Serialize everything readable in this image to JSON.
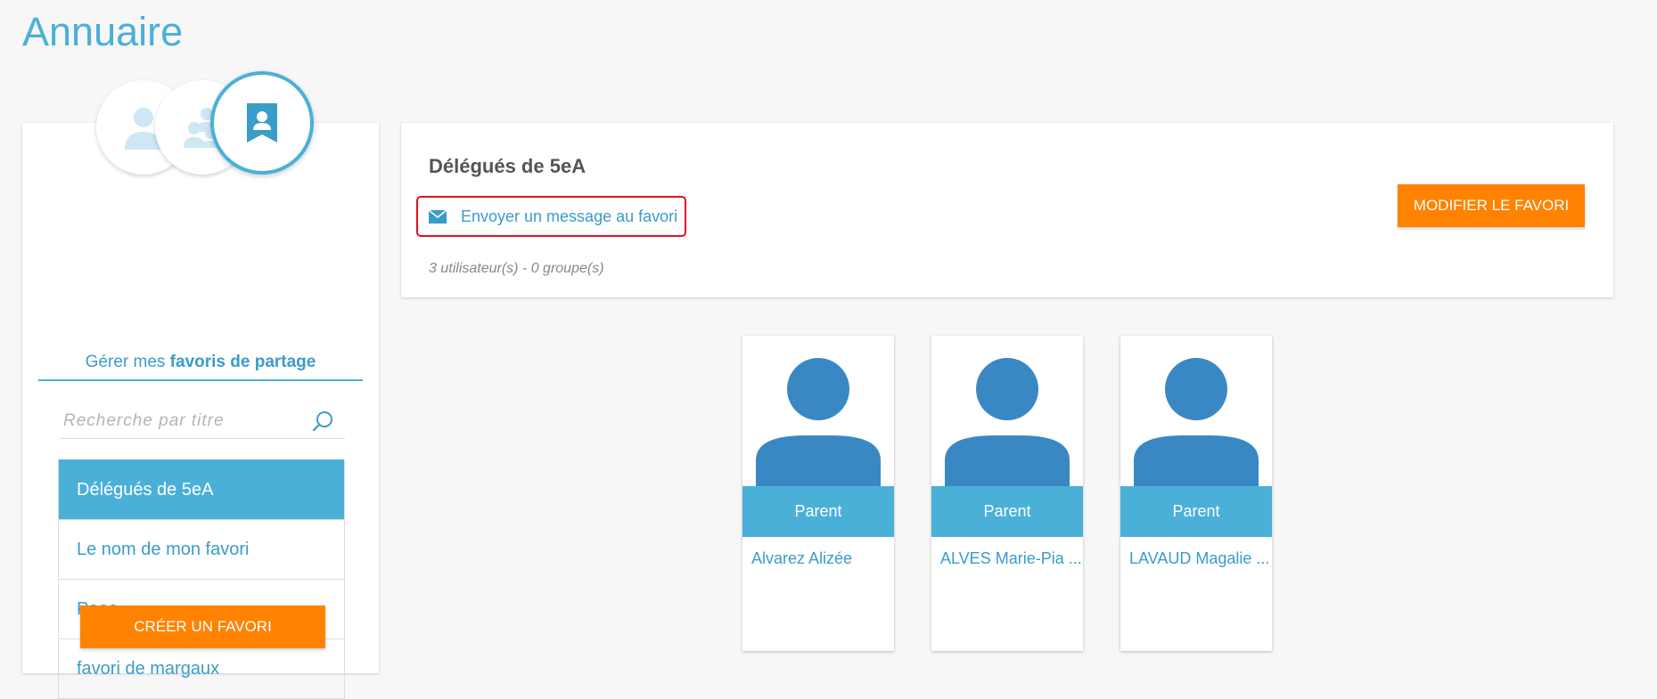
{
  "page": {
    "title": "Annuaire"
  },
  "sidebar": {
    "manage_label_prefix": "Gérer mes ",
    "manage_label_bold": "favoris de partage",
    "search_placeholder": "Recherche par titre",
    "favorites": [
      {
        "label": "Délégués de 5eA",
        "active": true
      },
      {
        "label": "Le nom de mon favori",
        "active": false
      },
      {
        "label": "Paoa",
        "active": false
      },
      {
        "label": "favori de margaux",
        "active": false
      }
    ],
    "create_button": "CRÉER UN FAVORI"
  },
  "favorite_detail": {
    "title": "Délégués de 5eA",
    "send_message_label": "Envoyer un message au favori",
    "counts": "3 utilisateur(s) - 0 groupe(s)",
    "modify_button": "MODIFIER LE FAVORI"
  },
  "members": [
    {
      "role": "Parent",
      "name": "Alvarez Alizée"
    },
    {
      "role": "Parent",
      "name": "ALVES Marie-Pia ..."
    },
    {
      "role": "Parent",
      "name": "LAVAUD Magalie ..."
    }
  ],
  "colors": {
    "accent": "#4ab0d8",
    "accent_dark": "#3a88c3",
    "button_orange": "#ff8200",
    "highlight_red": "#e0101a",
    "background": "#f7f7f7"
  },
  "icons": {
    "user_icon": "user-icon",
    "group_icon": "group-icon",
    "favorite_icon": "bookmark-contact-icon",
    "search_icon": "search-icon",
    "mail_icon": "envelope-icon",
    "avatar_placeholder": "user-silhouette-icon"
  }
}
